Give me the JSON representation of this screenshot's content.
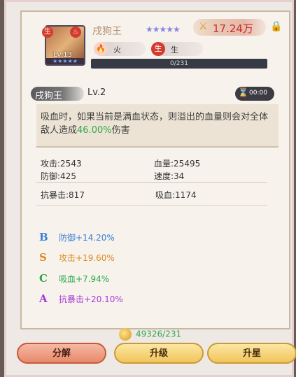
{
  "hero": {
    "name": "戌狗王",
    "rarity_stars": "★★★★★",
    "power": "17.24万",
    "portrait_level": "Lv:13",
    "portrait_stars": "★★★★★",
    "portrait_badge": "生",
    "element1": {
      "glyph": "🔥",
      "label": "火"
    },
    "element2": {
      "glyph": "生",
      "label": "生"
    },
    "exp_text": "0/231",
    "exp_fraction": 0.0
  },
  "skill": {
    "name": "戌狗王",
    "level": "Lv.2",
    "timer": "00:00",
    "desc_prefix": "吸血时，如果当前是满血状态，则溢出的血量则会对全体敌人造成",
    "desc_highlight": "46.00%",
    "desc_suffix": "伤害"
  },
  "stats": {
    "attack": "攻击:2543",
    "hp": "血量:25495",
    "defense": "防御:425",
    "speed": "速度:34",
    "crit_resist": "抗暴击:817",
    "lifesteal": "吸血:1174"
  },
  "bonuses": [
    {
      "grade": "B",
      "text": "防御+14.20%",
      "color": "#3b82d6"
    },
    {
      "grade": "S",
      "text": "攻击+19.60%",
      "color": "#e08a1e"
    },
    {
      "grade": "C",
      "text": "吸血+7.94%",
      "color": "#2ea84a"
    },
    {
      "grade": "A",
      "text": "抗暴击+20.10%",
      "color": "#a63bd6"
    }
  ],
  "gold": "49326/231",
  "buttons": {
    "decompose": "分解",
    "upgrade": "升级",
    "star_up": "升星"
  },
  "colors": {
    "highlight": "#2ea84a",
    "power": "#c72e2e"
  }
}
